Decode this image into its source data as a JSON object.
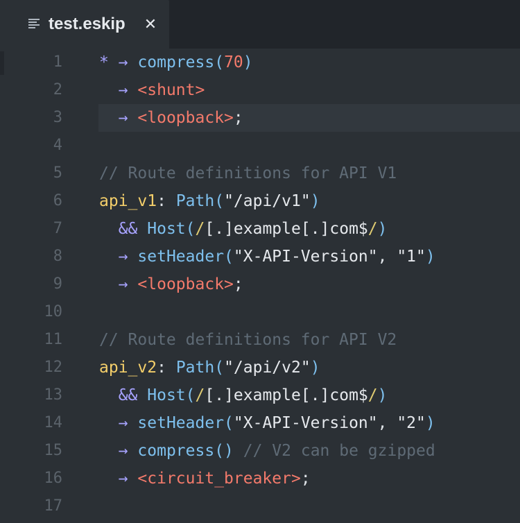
{
  "tab": {
    "title": "test.eskip",
    "close_glyph": "✕",
    "icon": "file-lines-icon"
  },
  "gutter": [
    "1",
    "2",
    "3",
    "4",
    "5",
    "6",
    "7",
    "8",
    "9",
    "10",
    "11",
    "12",
    "13",
    "14",
    "15",
    "16",
    "17"
  ],
  "colors": {
    "background": "#2b3035",
    "tabbar": "#21252a",
    "function": "#7ec0ee",
    "number_shunt": "#f47a6b",
    "route_id": "#f3ce6a",
    "operator": "#a7a3ff",
    "comment": "#5f6b76"
  },
  "code": {
    "l1": {
      "star": "*",
      "arrow": "→",
      "fn": "compress",
      "open": "(",
      "num": "70",
      "close": ")"
    },
    "l2": {
      "arrow": "→",
      "shunt": "<shunt>"
    },
    "l3": {
      "arrow": "→",
      "shunt": "<loopback>",
      "semi": ";"
    },
    "l5": {
      "comment": "// Route definitions for API V1"
    },
    "l6": {
      "id": "api_v1",
      "colon": ":",
      "fn": "Path",
      "open": "(",
      "str": "\"/api/v1\"",
      "close": ")"
    },
    "l7": {
      "and": "&&",
      "fn": "Host",
      "open": "(",
      "re_open": "/",
      "re": "[.]example[.]com$",
      "re_close": "/",
      "close": ")"
    },
    "l8": {
      "arrow": "→",
      "fn": "setHeader",
      "open": "(",
      "str1": "\"X-API-Version\"",
      "comma": ", ",
      "str2": "\"1\"",
      "close": ")"
    },
    "l9": {
      "arrow": "→",
      "shunt": "<loopback>",
      "semi": ";"
    },
    "l11": {
      "comment": "// Route definitions for API V2"
    },
    "l12": {
      "id": "api_v2",
      "colon": ":",
      "fn": "Path",
      "open": "(",
      "str": "\"/api/v2\"",
      "close": ")"
    },
    "l13": {
      "and": "&&",
      "fn": "Host",
      "open": "(",
      "re_open": "/",
      "re": "[.]example[.]com$",
      "re_close": "/",
      "close": ")"
    },
    "l14": {
      "arrow": "→",
      "fn": "setHeader",
      "open": "(",
      "str1": "\"X-API-Version\"",
      "comma": ", ",
      "str2": "\"2\"",
      "close": ")"
    },
    "l15": {
      "arrow": "→",
      "fn": "compress",
      "parens": "()",
      "comment": "// V2 can be gzipped"
    },
    "l16": {
      "arrow": "→",
      "shunt": "<circuit_breaker>",
      "semi": ";"
    }
  }
}
